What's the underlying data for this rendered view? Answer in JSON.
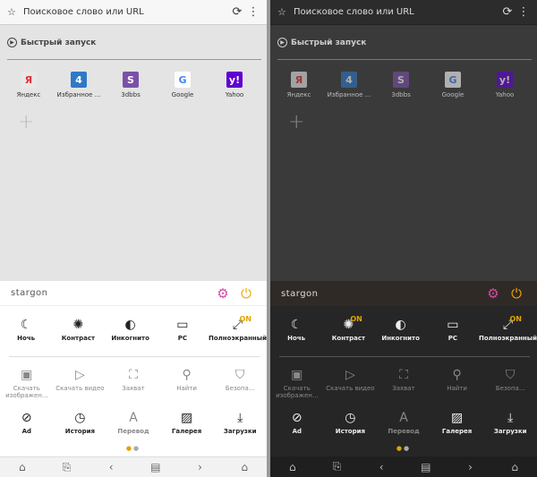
{
  "colors": {
    "accent": "#e0a400",
    "gear": "#d24ca3",
    "power": "#f0a500"
  },
  "panels": {
    "light": {
      "url_placeholder": "Поисковое слово или URL",
      "quick_launch": "Быстрый запуск",
      "dials": [
        {
          "label": "Яндекс",
          "tile_text": "Я",
          "color": "#e8e8e8",
          "text_color": "#d33",
          "icon": "yandex-icon"
        },
        {
          "label": "Избранное ...",
          "tile_text": "4",
          "color": "#2e79c7",
          "text_color": "#fff",
          "icon": "bookmarks-icon"
        },
        {
          "label": "3dbbs",
          "tile_text": "S",
          "color": "#7b51a8",
          "text_color": "#fff",
          "icon": "3dbbs-icon"
        },
        {
          "label": "Google",
          "tile_text": "G",
          "color": "#ffffff",
          "text_color": "#4285f4",
          "icon": "google-icon"
        },
        {
          "label": "Yahoo",
          "tile_text": "y!",
          "color": "#6001d2",
          "text_color": "#fff",
          "icon": "yahoo-icon"
        }
      ],
      "brand": "stargon",
      "toggles": [
        {
          "label": "Ночь",
          "glyph": "☾",
          "on": false
        },
        {
          "label": "Контраст",
          "glyph": "✺",
          "on": false
        },
        {
          "label": "Инкогнито",
          "glyph": "◐",
          "on": false
        },
        {
          "label": "PC",
          "glyph": "▭",
          "on": false
        },
        {
          "label": "Полноэкранный",
          "glyph": "⤢",
          "on": true
        }
      ],
      "actions": [
        {
          "label": "Скачать изображен...",
          "glyph": "▣"
        },
        {
          "label": "Скачать видео",
          "glyph": "▷"
        },
        {
          "label": "Захват",
          "glyph": "⛶"
        },
        {
          "label": "Найти",
          "glyph": "⚲"
        },
        {
          "label": "Безопа...",
          "glyph": "⛉"
        }
      ],
      "tools": [
        {
          "label": "Ad",
          "glyph": "⊘",
          "dim": false
        },
        {
          "label": "История",
          "glyph": "◷",
          "dim": false
        },
        {
          "label": "Перевод",
          "glyph": "A",
          "dim": true
        },
        {
          "label": "Галерея",
          "glyph": "▨",
          "dim": false
        },
        {
          "label": "Загрузки",
          "glyph": "⤓",
          "dim": false
        }
      ]
    },
    "dark": {
      "url_placeholder": "Поисковое слово или URL",
      "quick_launch": "Быстрый запуск",
      "dials": [
        {
          "label": "Яндекс",
          "tile_text": "Я",
          "color": "#e8e8e8",
          "text_color": "#d33",
          "icon": "yandex-icon"
        },
        {
          "label": "Избранное ...",
          "tile_text": "4",
          "color": "#2e79c7",
          "text_color": "#fff",
          "icon": "bookmarks-icon"
        },
        {
          "label": "3dbbs",
          "tile_text": "S",
          "color": "#7b51a8",
          "text_color": "#fff",
          "icon": "3dbbs-icon"
        },
        {
          "label": "Google",
          "tile_text": "G",
          "color": "#ffffff",
          "text_color": "#4285f4",
          "icon": "google-icon"
        },
        {
          "label": "Yahoo",
          "tile_text": "y!",
          "color": "#6001d2",
          "text_color": "#fff",
          "icon": "yahoo-icon"
        }
      ],
      "brand": "stargon",
      "toggles": [
        {
          "label": "Ночь",
          "glyph": "☾",
          "on": false
        },
        {
          "label": "Контраст",
          "glyph": "✺",
          "on": true
        },
        {
          "label": "Инкогнито",
          "glyph": "◐",
          "on": false
        },
        {
          "label": "PC",
          "glyph": "▭",
          "on": false
        },
        {
          "label": "Полноэкранный",
          "glyph": "⤢",
          "on": true
        }
      ],
      "actions": [
        {
          "label": "Скачать изображен...",
          "glyph": "▣"
        },
        {
          "label": "Скачать видео",
          "glyph": "▷"
        },
        {
          "label": "Захват",
          "glyph": "⛶"
        },
        {
          "label": "Найти",
          "glyph": "⚲"
        },
        {
          "label": "Безопа...",
          "glyph": "⛉"
        }
      ],
      "tools": [
        {
          "label": "Ad",
          "glyph": "⊘",
          "dim": false
        },
        {
          "label": "История",
          "glyph": "◷",
          "dim": false
        },
        {
          "label": "Перевод",
          "glyph": "A",
          "dim": true
        },
        {
          "label": "Галерея",
          "glyph": "▨",
          "dim": false
        },
        {
          "label": "Загрузки",
          "glyph": "⤓",
          "dim": false
        }
      ]
    }
  },
  "on_badge": "ON"
}
